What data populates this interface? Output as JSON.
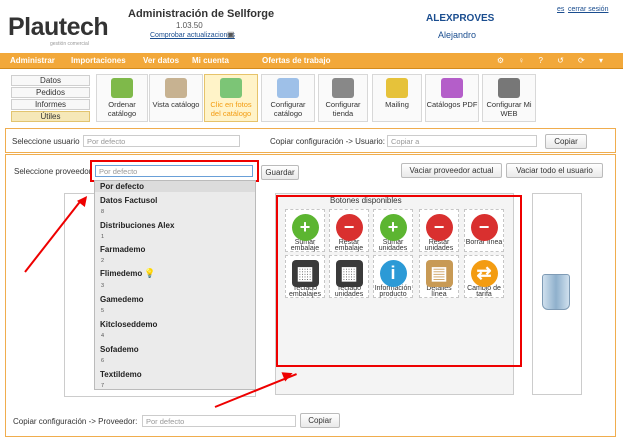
{
  "header": {
    "logo_main": "Plautech",
    "logo_sub": "gestión comercial",
    "app_title": "Administración de Sellforge",
    "version": "1.03.50",
    "check_updates": "Comprobar actualizaciones",
    "company": "ALEXPROVES",
    "user": "Alejandro",
    "lang": "es",
    "logout": "cerrar sesión"
  },
  "menu": {
    "items": [
      "Administrar",
      "Importaciones",
      "Ver datos",
      "Mi cuenta",
      "Ofertas de trabajo"
    ],
    "icons": "⚙ ♀ ? ↺ ⟳ ▾"
  },
  "categories": [
    "Datos",
    "Pedidos",
    "Informes",
    "Útiles"
  ],
  "tools": [
    {
      "label1": "Ordenar",
      "label2": "catálogo",
      "color": "#7fb94a"
    },
    {
      "label1": "Vista catálogo",
      "label2": "",
      "color": "#9a7b5a"
    },
    {
      "label1": "Clic en fotos",
      "label2": "del catálogo",
      "color": "#7cc576"
    },
    {
      "label1": "Configurar",
      "label2": "catálogo",
      "color": "#4a8fd6"
    },
    {
      "label1": "Configurar",
      "label2": "tienda",
      "color": "#666666"
    },
    {
      "label1": "Mailing",
      "label2": "",
      "color": "#e6c23a"
    },
    {
      "label1": "Catálogos PDF",
      "label2": "",
      "color": "#b45ec9"
    },
    {
      "label1": "Configurar Mi",
      "label2": "WEB",
      "color": "#555555"
    }
  ],
  "row1": {
    "select_user_label": "Seleccione usuario",
    "select_user_value": "Por defecto",
    "copy_config_label": "Copiar configuración -> Usuario:",
    "copy_placeholder": "Copiar a",
    "copy_button": "Copiar"
  },
  "row2": {
    "select_provider_label": "Seleccione proveedor",
    "provider_placeholder": "Por defecto",
    "save_button": "Guardar",
    "clear_provider_button": "Vaciar proveedor actual",
    "clear_user_button": "Vaciar todo el usuario"
  },
  "dropdown": [
    {
      "name": "Por defecto",
      "num": ""
    },
    {
      "name": "Datos Factusol",
      "num": "8"
    },
    {
      "name": "Distribuciones Alex",
      "num": "1"
    },
    {
      "name": "Farmademo",
      "num": "2"
    },
    {
      "name": "Flimedemo",
      "num": "3"
    },
    {
      "name": "Gamedemo",
      "num": "5"
    },
    {
      "name": "Kitcloseddemo",
      "num": "4"
    },
    {
      "name": "Sofademo",
      "num": "6"
    },
    {
      "name": "Textildemo",
      "num": "7"
    }
  ],
  "buttons_panel": {
    "title": "Botones disponibles",
    "actions": [
      {
        "label1": "Sumar",
        "label2": "embalaje",
        "color": "#5cb531",
        "glyph": "+"
      },
      {
        "label1": "Restar",
        "label2": "embalaje",
        "color": "#d9302f",
        "glyph": "−"
      },
      {
        "label1": "Sumar",
        "label2": "unidades",
        "color": "#5cb531",
        "glyph": "+"
      },
      {
        "label1": "Restar",
        "label2": "unidades",
        "color": "#d9302f",
        "glyph": "−"
      },
      {
        "label1": "Borrar línea",
        "label2": "",
        "color": "#d9302f",
        "glyph": "−"
      },
      {
        "label1": "Teclado",
        "label2": "embalajes",
        "color": "#3a3a3a",
        "glyph": "▦"
      },
      {
        "label1": "Teclado",
        "label2": "unidades",
        "color": "#3a3a3a",
        "glyph": "▦"
      },
      {
        "label1": "Información",
        "label2": "producto",
        "color": "#2c9ad6",
        "glyph": "i"
      },
      {
        "label1": "Detalles",
        "label2": "línea",
        "color": "#c89a55",
        "glyph": "▤"
      },
      {
        "label1": "Cambio de",
        "label2": "tarifa",
        "color": "#f39c12",
        "glyph": "⇄"
      }
    ]
  },
  "footer": {
    "copy_provider_label": "Copiar configuración -> Proveedor:",
    "copy_provider_value": "Por defecto",
    "copy_button": "Copiar"
  }
}
